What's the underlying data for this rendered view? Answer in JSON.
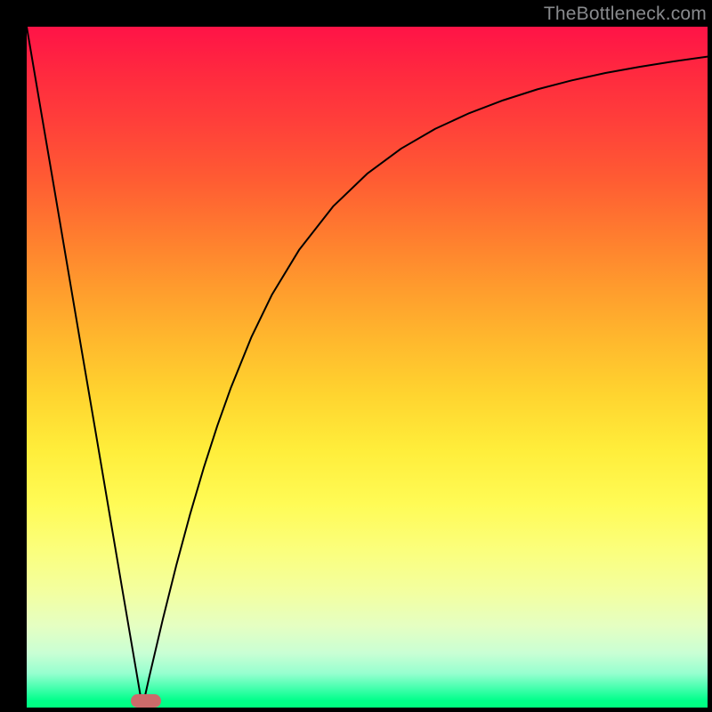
{
  "watermark": "TheBottleneck.com",
  "colors": {
    "curve": "#000000",
    "marker": "#cc6b6b",
    "frame": "#000000"
  },
  "chart_data": {
    "type": "line",
    "title": "",
    "xlabel": "",
    "ylabel": "",
    "xlim": [
      0,
      100
    ],
    "ylim": [
      0,
      100
    ],
    "grid": false,
    "legend": false,
    "description": "V-shaped bottleneck curve: a steep linear descent from the top-left to a cusp near the bottom, then an asymptotic rise toward the right edge over a vertical green→red gradient background.",
    "cusp": {
      "x": 17,
      "y": 0
    },
    "marker": {
      "x_center": 17.5,
      "y": 0,
      "width_pct": 4.5,
      "height_pct": 2
    },
    "series": [
      {
        "name": "curve",
        "x": [
          0,
          2,
          4,
          6,
          8,
          10,
          12,
          14,
          16,
          17,
          18,
          20,
          22,
          24,
          26,
          28,
          30,
          33,
          36,
          40,
          45,
          50,
          55,
          60,
          65,
          70,
          75,
          80,
          85,
          90,
          95,
          100
        ],
        "y": [
          100,
          88.2,
          76.5,
          64.7,
          52.9,
          41.2,
          29.4,
          17.6,
          5.9,
          0,
          4.5,
          13.0,
          21.0,
          28.4,
          35.2,
          41.4,
          47.0,
          54.4,
          60.6,
          67.2,
          73.6,
          78.4,
          82.1,
          85.0,
          87.3,
          89.2,
          90.8,
          92.1,
          93.2,
          94.1,
          94.9,
          95.6
        ]
      }
    ]
  }
}
